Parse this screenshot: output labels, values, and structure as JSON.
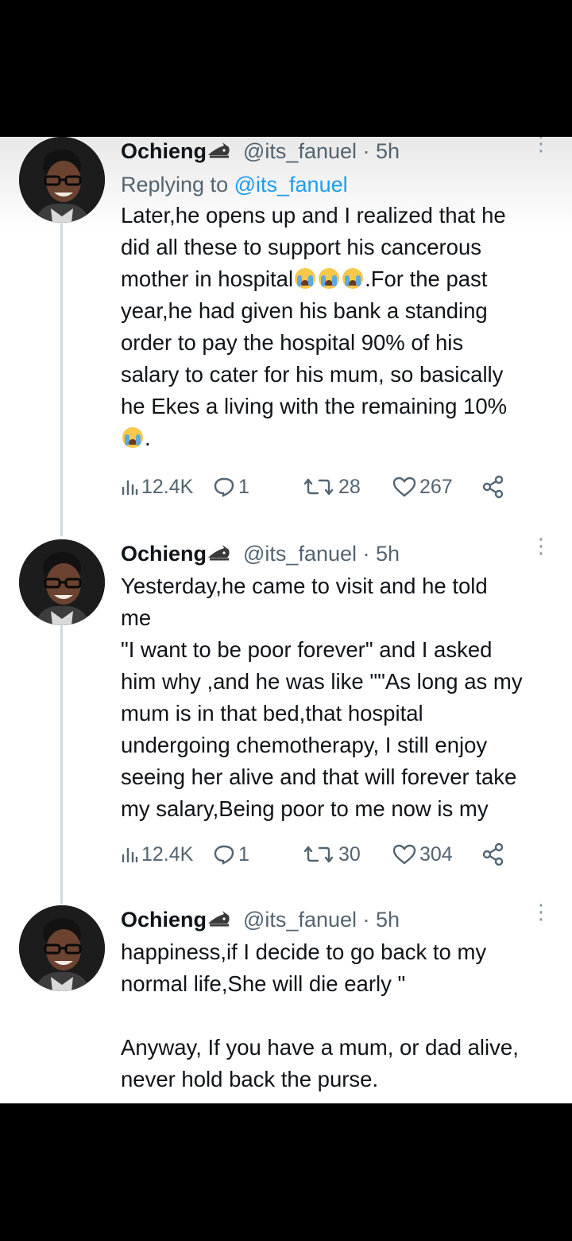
{
  "tweets": [
    {
      "author": "Ochieng",
      "handle": "@its_fanuel",
      "time": "· 5h",
      "replying_prefix": "Replying to",
      "replying_to": "@its_fanuel",
      "text_lines": [
        "Later,he opens up and I realized that he",
        "did all these to support his cancerous",
        "mother in hospital",
        ".For the past",
        "year,he had given his bank a standing",
        "order to pay the hospital 90% of his",
        "salary to cater for his mum, so basically",
        "he Ekes a living with the remaining 10%",
        "."
      ],
      "stats": {
        "views": "12.4K",
        "replies": "1",
        "retweets": "28",
        "likes": "267"
      }
    },
    {
      "author": "Ochieng",
      "handle": "@its_fanuel",
      "time": "· 5h",
      "text_lines": [
        "Yesterday,he came to visit and he told",
        "me",
        "\"I want to be poor forever\" and I asked",
        "him why ,and he was like \"\"As long as my",
        "mum is in that bed,that hospital",
        "undergoing chemotherapy, I still enjoy",
        "seeing her alive and that will forever take",
        "my salary,Being poor to me now is my"
      ],
      "stats": {
        "views": "12.4K",
        "replies": "1",
        "retweets": "30",
        "likes": "304"
      }
    },
    {
      "author": "Ochieng",
      "handle": "@its_fanuel",
      "time": "· 5h",
      "text_lines": [
        "happiness,if I decide to go back to my",
        "normal life,She will die early \"",
        "",
        "Anyway, If you have a mum, or dad alive,",
        "never hold back the purse."
      ]
    }
  ],
  "icons": {
    "views": "bar-chart-icon",
    "reply": "speech-bubble-icon",
    "retweet": "retweet-icon",
    "like": "heart-icon",
    "share": "share-nodes-icon",
    "badge": "shark-badge-icon",
    "emoji": "loudly-crying-face-emoji",
    "more": "more-vertical-icon"
  },
  "colors": {
    "text": "#0f1419",
    "secondary": "#536471",
    "mention": "#1d9bf0",
    "thread_line": "#cfd9de"
  }
}
